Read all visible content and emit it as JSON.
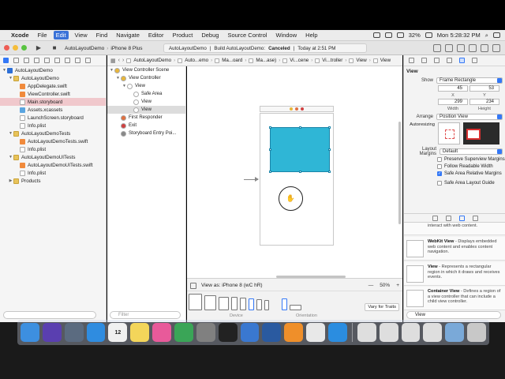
{
  "menubar": {
    "items": [
      "Xcode",
      "File",
      "Edit",
      "View",
      "Find",
      "Navigate",
      "Editor",
      "Product",
      "Debug",
      "Source Control",
      "Window",
      "Help"
    ],
    "active_index": 2,
    "battery": "32%",
    "clock": "Mon 5:28:32 PM"
  },
  "toolbar": {
    "scheme": "AutoLayoutDemo",
    "device": "iPhone 8 Plus",
    "status_project": "AutoLayoutDemo",
    "status_build": "Build AutoLayoutDemo:",
    "status_result": "Canceled",
    "status_time": "Today at 2:51 PM"
  },
  "navigator": {
    "rows": [
      {
        "label": "AutoLayoutDemo",
        "indent": 0,
        "tri": "▼",
        "icon": "proj",
        "selected": false
      },
      {
        "label": "AutoLayoutDemo",
        "indent": 1,
        "tri": "▼",
        "icon": "folder",
        "selected": false
      },
      {
        "label": "AppDelegate.swift",
        "indent": 2,
        "tri": "",
        "icon": "swift",
        "selected": false
      },
      {
        "label": "ViewController.swift",
        "indent": 2,
        "tri": "",
        "icon": "swift",
        "selected": false
      },
      {
        "label": "Main.storyboard",
        "indent": 2,
        "tri": "",
        "icon": "file",
        "selected": true
      },
      {
        "label": "Assets.xcassets",
        "indent": 2,
        "tri": "",
        "icon": "assets",
        "selected": false
      },
      {
        "label": "LaunchScreen.storyboard",
        "indent": 2,
        "tri": "",
        "icon": "file",
        "selected": false
      },
      {
        "label": "Info.plist",
        "indent": 2,
        "tri": "",
        "icon": "file",
        "selected": false
      },
      {
        "label": "AutoLayoutDemoTests",
        "indent": 1,
        "tri": "▼",
        "icon": "folder",
        "selected": false
      },
      {
        "label": "AutoLayoutDemoTests.swift",
        "indent": 2,
        "tri": "",
        "icon": "swift",
        "selected": false
      },
      {
        "label": "Info.plist",
        "indent": 2,
        "tri": "",
        "icon": "file",
        "selected": false
      },
      {
        "label": "AutoLayoutDemoUITests",
        "indent": 1,
        "tri": "▼",
        "icon": "folder",
        "selected": false
      },
      {
        "label": "AutoLayoutDemoUITests.swift",
        "indent": 2,
        "tri": "",
        "icon": "swift",
        "selected": false
      },
      {
        "label": "Info.plist",
        "indent": 2,
        "tri": "",
        "icon": "file",
        "selected": false
      },
      {
        "label": "Products",
        "indent": 1,
        "tri": "▶",
        "icon": "folder",
        "selected": false
      }
    ]
  },
  "jumpbar": {
    "crumbs": [
      "AutoLayoutDemo",
      "Auto...emo",
      "Ma...oard",
      "Ma...ase)",
      "Vi...cene",
      "Vi...troller",
      "View",
      "View"
    ]
  },
  "outline": {
    "rows": [
      {
        "label": "View Controller Scene",
        "indent": 0,
        "tri": "▼",
        "color": "#e8b63a",
        "selected": false
      },
      {
        "label": "View Controller",
        "indent": 1,
        "tri": "▼",
        "color": "#e8b63a",
        "selected": false
      },
      {
        "label": "View",
        "indent": 2,
        "tri": "▼",
        "color": "#ffffff",
        "selected": false
      },
      {
        "label": "Safe Area",
        "indent": 3,
        "tri": "",
        "color": "#ffffff",
        "selected": false
      },
      {
        "label": "View",
        "indent": 3,
        "tri": "",
        "color": "#ffffff",
        "selected": false
      },
      {
        "label": "View",
        "indent": 3,
        "tri": "",
        "color": "#ffffff",
        "selected": true
      },
      {
        "label": "First Responder",
        "indent": 1,
        "tri": "",
        "color": "#e07040",
        "selected": false
      },
      {
        "label": "Exit",
        "indent": 1,
        "tri": "",
        "color": "#d04040",
        "selected": false
      },
      {
        "label": "Storyboard Entry Poi...",
        "indent": 1,
        "tri": "",
        "color": "#888888",
        "selected": false
      }
    ],
    "filter_placeholder": "Filter"
  },
  "canvas_bottom": {
    "view_as": "View as: iPhone 8 (wC hR)",
    "zoom_minus": "—",
    "zoom_level": "50%",
    "zoom_plus": "+",
    "device_label": "Device",
    "orientation_label": "Orientation",
    "vary_button": "Vary for Traits"
  },
  "inspector": {
    "title": "View",
    "show_label": "Show",
    "show_value": "Frame Rectangle",
    "x_value": "45",
    "y_value": "53",
    "x_label": "X",
    "y_label": "Y",
    "width_value": "299",
    "height_value": "234",
    "width_label": "Width",
    "height_label": "Height",
    "arrange_label": "Arrange",
    "arrange_value": "Position View",
    "autoresizing_label": "Autoresizing",
    "layout_margins_label": "Layout Margins",
    "layout_margins_value": "Default",
    "checkboxes": [
      {
        "label": "Preserve Superview Margins",
        "checked": false
      },
      {
        "label": "Follow Readable Width",
        "checked": false
      },
      {
        "label": "Safe Area Relative Margins",
        "checked": true
      },
      {
        "label": "Safe Area Layout Guide",
        "checked": false
      }
    ],
    "library": [
      {
        "title": "",
        "desc": "interact with web content."
      },
      {
        "title": "WebKit View",
        "desc": "- Displays embedded web content and enables content navigation."
      },
      {
        "title": "View",
        "desc": "- Represents a rectangular region in which it draws and receives events."
      },
      {
        "title": "Container View",
        "desc": "- Defines a region of a view controller that can include a child view controller."
      }
    ],
    "library_filter": "View"
  },
  "dock": {
    "apps": [
      {
        "name": "Finder",
        "color": "#3d8fe0"
      },
      {
        "name": "Siri",
        "color": "#5a3fb0"
      },
      {
        "name": "Launchpad",
        "color": "#5b6b80"
      },
      {
        "name": "Safari",
        "color": "#2f8ce0"
      },
      {
        "name": "Calendar",
        "color": "#f0f0f0"
      },
      {
        "name": "Notes",
        "color": "#f3d55a"
      },
      {
        "name": "iTunes",
        "color": "#e85a9a"
      },
      {
        "name": "Chrome",
        "color": "#3aa557"
      },
      {
        "name": "System Preferences",
        "color": "#808080"
      },
      {
        "name": "Terminal",
        "color": "#222222"
      },
      {
        "name": "Xcode Helper",
        "color": "#3a78d0"
      },
      {
        "name": "QuickTime",
        "color": "#2a5aa0"
      },
      {
        "name": "Sublime",
        "color": "#ef8f2a"
      },
      {
        "name": "TextEdit",
        "color": "#e8e8e8"
      },
      {
        "name": "Xcode",
        "color": "#2b8de0"
      },
      {
        "name": "Document 1",
        "color": "#dedede"
      },
      {
        "name": "Document 2",
        "color": "#dedede"
      },
      {
        "name": "Document 3",
        "color": "#dedede"
      },
      {
        "name": "Document 4",
        "color": "#dedede"
      },
      {
        "name": "Downloads",
        "color": "#7aa9d8"
      },
      {
        "name": "Trash",
        "color": "#c8c8c8"
      }
    ],
    "calendar_day": "12"
  }
}
